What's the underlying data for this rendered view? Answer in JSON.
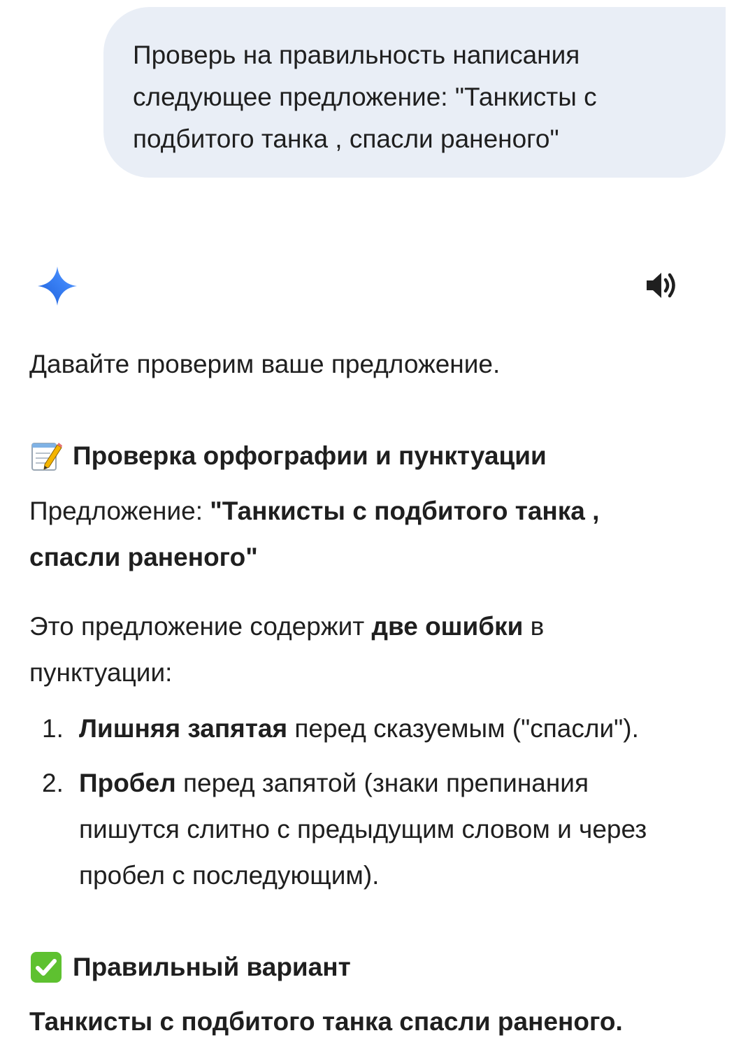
{
  "user_message": {
    "lines": [
      "Проверь на правильность написания",
      "следующее предложение: \"Танкисты с",
      "подбитого танка , спасли раненого\""
    ]
  },
  "assistant": {
    "icon": "gemini-sparkle-icon",
    "speaker_icon": "speaker-icon",
    "accent_color": "#4285f4",
    "intro": "Давайте проверим ваше предложение.",
    "section1": {
      "emoji": "memo-icon",
      "title": "Проверка орфографии и пунктуации",
      "sentence_label": "Предложение: ",
      "sentence_bold_line1": "\"Танкисты с подбитого танка ,",
      "sentence_bold_line2": "спасли раненого\"",
      "summary_pre": "Это предложение содержит ",
      "summary_bold": "две ошибки",
      "summary_post": " в",
      "summary_line2": "пунктуации:",
      "errors": [
        {
          "num": "1.",
          "bold": "Лишняя запятая",
          "rest": " перед сказуемым (\"спасли\")."
        },
        {
          "num": "2.",
          "bold": "Пробел",
          "rest": " перед запятой (знаки препинания",
          "line2": "пишутся слитно с предыдущим словом и через",
          "line3": "пробел с последующим)."
        }
      ]
    },
    "section2": {
      "emoji": "check-mark-icon",
      "title": "Правильный вариант",
      "corrected": "Танкисты с подбитого танка спасли раненого."
    }
  }
}
